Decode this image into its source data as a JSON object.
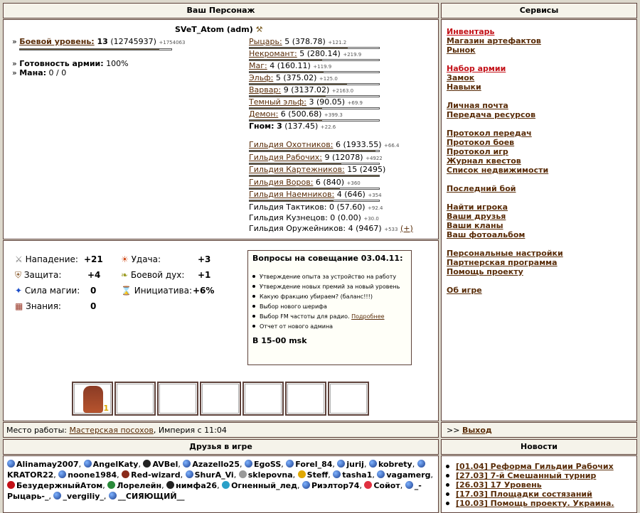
{
  "headers": {
    "character": "Ваш Персонаж",
    "services": "Сервисы",
    "friends": "Друзья в игре",
    "news": "Новости"
  },
  "character": {
    "name": "SVeT_Atom (adm)",
    "combat_level_label": "Боевой уровень:",
    "combat_level": "13",
    "combat_exp": "(12745937)",
    "combat_next": "+1754063",
    "army_label": "Готовность армии:",
    "army_value": "100%",
    "mana_label": "Мана:",
    "mana_value": "0 / 0"
  },
  "factions": [
    {
      "name": "Рыцарь:",
      "level": "5",
      "exp": "(378.78)",
      "next": "+121.2",
      "fill": 0.76
    },
    {
      "name": "Некромант:",
      "level": "5",
      "exp": "(280.14)",
      "next": "+219.9",
      "fill": 0.56
    },
    {
      "name": "Маг:",
      "level": "4",
      "exp": "(160.11)",
      "next": "+119.9",
      "fill": 0.57
    },
    {
      "name": "Эльф:",
      "level": "5",
      "exp": "(375.02)",
      "next": "+125.0",
      "fill": 0.75
    },
    {
      "name": "Варвар:",
      "level": "9",
      "exp": "(3137.02)",
      "next": "+2163.0",
      "fill": 0.59
    },
    {
      "name": "Темный эльф:",
      "level": "3",
      "exp": "(90.05)",
      "next": "+69.9",
      "fill": 0.56
    },
    {
      "name": "Демон:",
      "level": "6",
      "exp": "(500.68)",
      "next": "+399.3",
      "fill": 0.56
    }
  ],
  "gnome": {
    "name": "Гном:",
    "level": "3",
    "exp": "(137.45)",
    "next": "+22.6"
  },
  "guilds": [
    {
      "name": "Гильдия Охотников:",
      "level": "6",
      "exp": "(1933.55)",
      "next": "+66.4",
      "fill": 0.97
    },
    {
      "name": "Гильдия Рабочих:",
      "level": "9",
      "exp": "(12078)",
      "next": "+4922",
      "fill": 0.71
    },
    {
      "name": "Гильдия Картежников:",
      "level": "15",
      "exp": "(2495)",
      "next": "",
      "fill": 1.0
    },
    {
      "name": "Гильдия Воров:",
      "level": "6",
      "exp": "(840)",
      "next": "+360",
      "fill": 0.7
    },
    {
      "name": "Гильдия Наемников:",
      "level": "4",
      "exp": "(646)",
      "next": "+354",
      "fill": 0.65
    }
  ],
  "guilds_plain": [
    {
      "name": "Гильдия Тактиков:",
      "level": "0",
      "exp": "(57.60)",
      "next": "+92.4"
    },
    {
      "name": "Гильдия Кузнецов:",
      "level": "0",
      "exp": "(0.00)",
      "next": "+30.0"
    },
    {
      "name": "Гильдия Оружейников:",
      "level": "4",
      "exp": "(9467)",
      "next": "+533",
      "extra": "(+)"
    }
  ],
  "stats": {
    "attack_label": "Нападение:",
    "attack": "+21",
    "defense_label": "Защита:",
    "defense": "+4",
    "magic_label": "Сила магии:",
    "magic": "0",
    "knowledge_label": "Знания:",
    "knowledge": "0",
    "luck_label": "Удача:",
    "luck": "+3",
    "morale_label": "Боевой дух:",
    "morale": "+1",
    "initiative_label": "Инициатива:",
    "initiative": "+6%"
  },
  "meeting": {
    "title": "Вопросы на совещание 03.04.11:",
    "items": [
      "Утверждение опыта за устройство на работу",
      "Утверждение новых премий за новый уровень",
      "Какую фракцию убираем? (баланс!!!)",
      "Выбор нового шерифа",
      "Выбор FM частоты для радио.",
      "Отчет от нового админа"
    ],
    "more_link": "Подробнее",
    "time": "В 15-00 msk"
  },
  "slot_badge": "1",
  "work": {
    "label": "Место работы:",
    "place": "Мастерская посохов",
    "suffix": ", Империя с 11:04"
  },
  "exit": {
    "prefix": ">>",
    "label": "Выход"
  },
  "services": [
    {
      "label": "Инвентарь",
      "red": true
    },
    {
      "label": "Магазин артефактов"
    },
    {
      "label": "Рынок"
    },
    {
      "gap": true
    },
    {
      "label": "Набор армии",
      "red": true
    },
    {
      "label": "Замок"
    },
    {
      "label": "Навыки"
    },
    {
      "gap": true
    },
    {
      "label": "Личная почта"
    },
    {
      "label": "Передача ресурсов"
    },
    {
      "gap": true
    },
    {
      "label": "Протокол передач"
    },
    {
      "label": "Протокол боев"
    },
    {
      "label": "Протокол игр"
    },
    {
      "label": "Журнал квестов"
    },
    {
      "label": "Список недвижимости"
    },
    {
      "gap": true
    },
    {
      "label": "Последний бой"
    },
    {
      "gap": true
    },
    {
      "label": "Найти игрока"
    },
    {
      "label": "Ваши друзья"
    },
    {
      "label": "Ваши кланы"
    },
    {
      "label": "Ваш фотоальбом"
    },
    {
      "gap": true
    },
    {
      "label": "Персональные настройки"
    },
    {
      "label": "Партнерская программа"
    },
    {
      "label": "Помощь проекту"
    },
    {
      "gap": true
    },
    {
      "label": "Об игре"
    }
  ],
  "friends": [
    "Alinamay2007",
    "AngelKaty",
    "AVBel",
    "Azazello25",
    "EgoSS",
    "Forel_84",
    "jurij",
    "kobrety",
    "KRATOR22",
    "noone1984",
    "Red-wizard",
    "ShurA_Vi",
    "sklepovna",
    "Steff",
    "tasha1",
    "vagamerg",
    "БезудержныйАтом",
    "Лорелейн",
    "нимфа26",
    "Огненный_лед",
    "Риэлтор74",
    "Сойот",
    "_-Рыцарь-_",
    "_vergiliy_",
    "__СИЯЮЩИЙ__"
  ],
  "news": [
    "[01.04] Реформа Гильдии Рабочих",
    "[27.03] 7-й Смешанный турнир",
    "[26.03] 17 Уровень",
    "[17.03] Площадки состязаний",
    "[10.03] Помощь проекту. Украина."
  ]
}
